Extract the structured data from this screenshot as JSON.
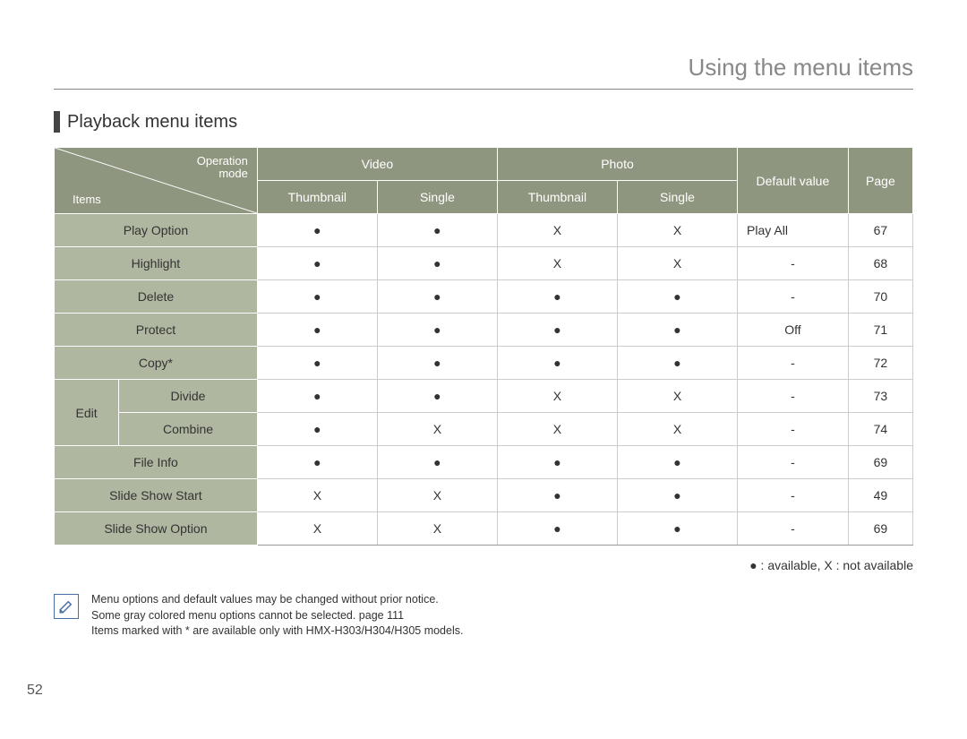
{
  "page_title": "Using the menu items",
  "section_title": "Playback menu items",
  "page_number": "52",
  "diag": {
    "top": "Operation\nmode",
    "bottom": "Items"
  },
  "headers": {
    "video": "Video",
    "photo": "Photo",
    "default": "Default value",
    "page": "Page",
    "thumb1": "Thumbnail",
    "single1": "Single",
    "thumb2": "Thumbnail",
    "single2": "Single"
  },
  "chart_data": {
    "type": "table",
    "columns": [
      "Item",
      "Video Thumbnail",
      "Video Single",
      "Photo Thumbnail",
      "Photo Single",
      "Default value",
      "Page"
    ],
    "rows": [
      {
        "item": "Play Option",
        "vt": "●",
        "vs": "●",
        "pt": "X",
        "ps": "X",
        "def": "Play All",
        "page": "67"
      },
      {
        "item": "Highlight",
        "vt": "●",
        "vs": "●",
        "pt": "X",
        "ps": "X",
        "def": "-",
        "page": "68"
      },
      {
        "item": "Delete",
        "vt": "●",
        "vs": "●",
        "pt": "●",
        "ps": "●",
        "def": "-",
        "page": "70"
      },
      {
        "item": "Protect",
        "vt": "●",
        "vs": "●",
        "pt": "●",
        "ps": "●",
        "def": "Off",
        "page": "71"
      },
      {
        "item": "Copy*",
        "vt": "●",
        "vs": "●",
        "pt": "●",
        "ps": "●",
        "def": "-",
        "page": "72"
      },
      {
        "group": "Edit",
        "sub": "Divide",
        "vt": "●",
        "vs": "●",
        "pt": "X",
        "ps": "X",
        "def": "-",
        "page": "73"
      },
      {
        "group": "Edit",
        "sub": "Combine",
        "vt": "●",
        "vs": "X",
        "pt": "X",
        "ps": "X",
        "def": "-",
        "page": "74"
      },
      {
        "item": "File Info",
        "vt": "●",
        "vs": "●",
        "pt": "●",
        "ps": "●",
        "def": "-",
        "page": "69"
      },
      {
        "item": "Slide Show Start",
        "vt": "X",
        "vs": "X",
        "pt": "●",
        "ps": "●",
        "def": "-",
        "page": "49"
      },
      {
        "item": "Slide Show Option",
        "vt": "X",
        "vs": "X",
        "pt": "●",
        "ps": "●",
        "def": "-",
        "page": "69"
      }
    ]
  },
  "legend": "● : available, X : not available",
  "notes": [
    "Menu options and default values may be changed without prior notice.",
    "Some gray colored menu options cannot be selected. page 111",
    "Items marked with * are available only with HMX-H303/H304/H305 models."
  ]
}
